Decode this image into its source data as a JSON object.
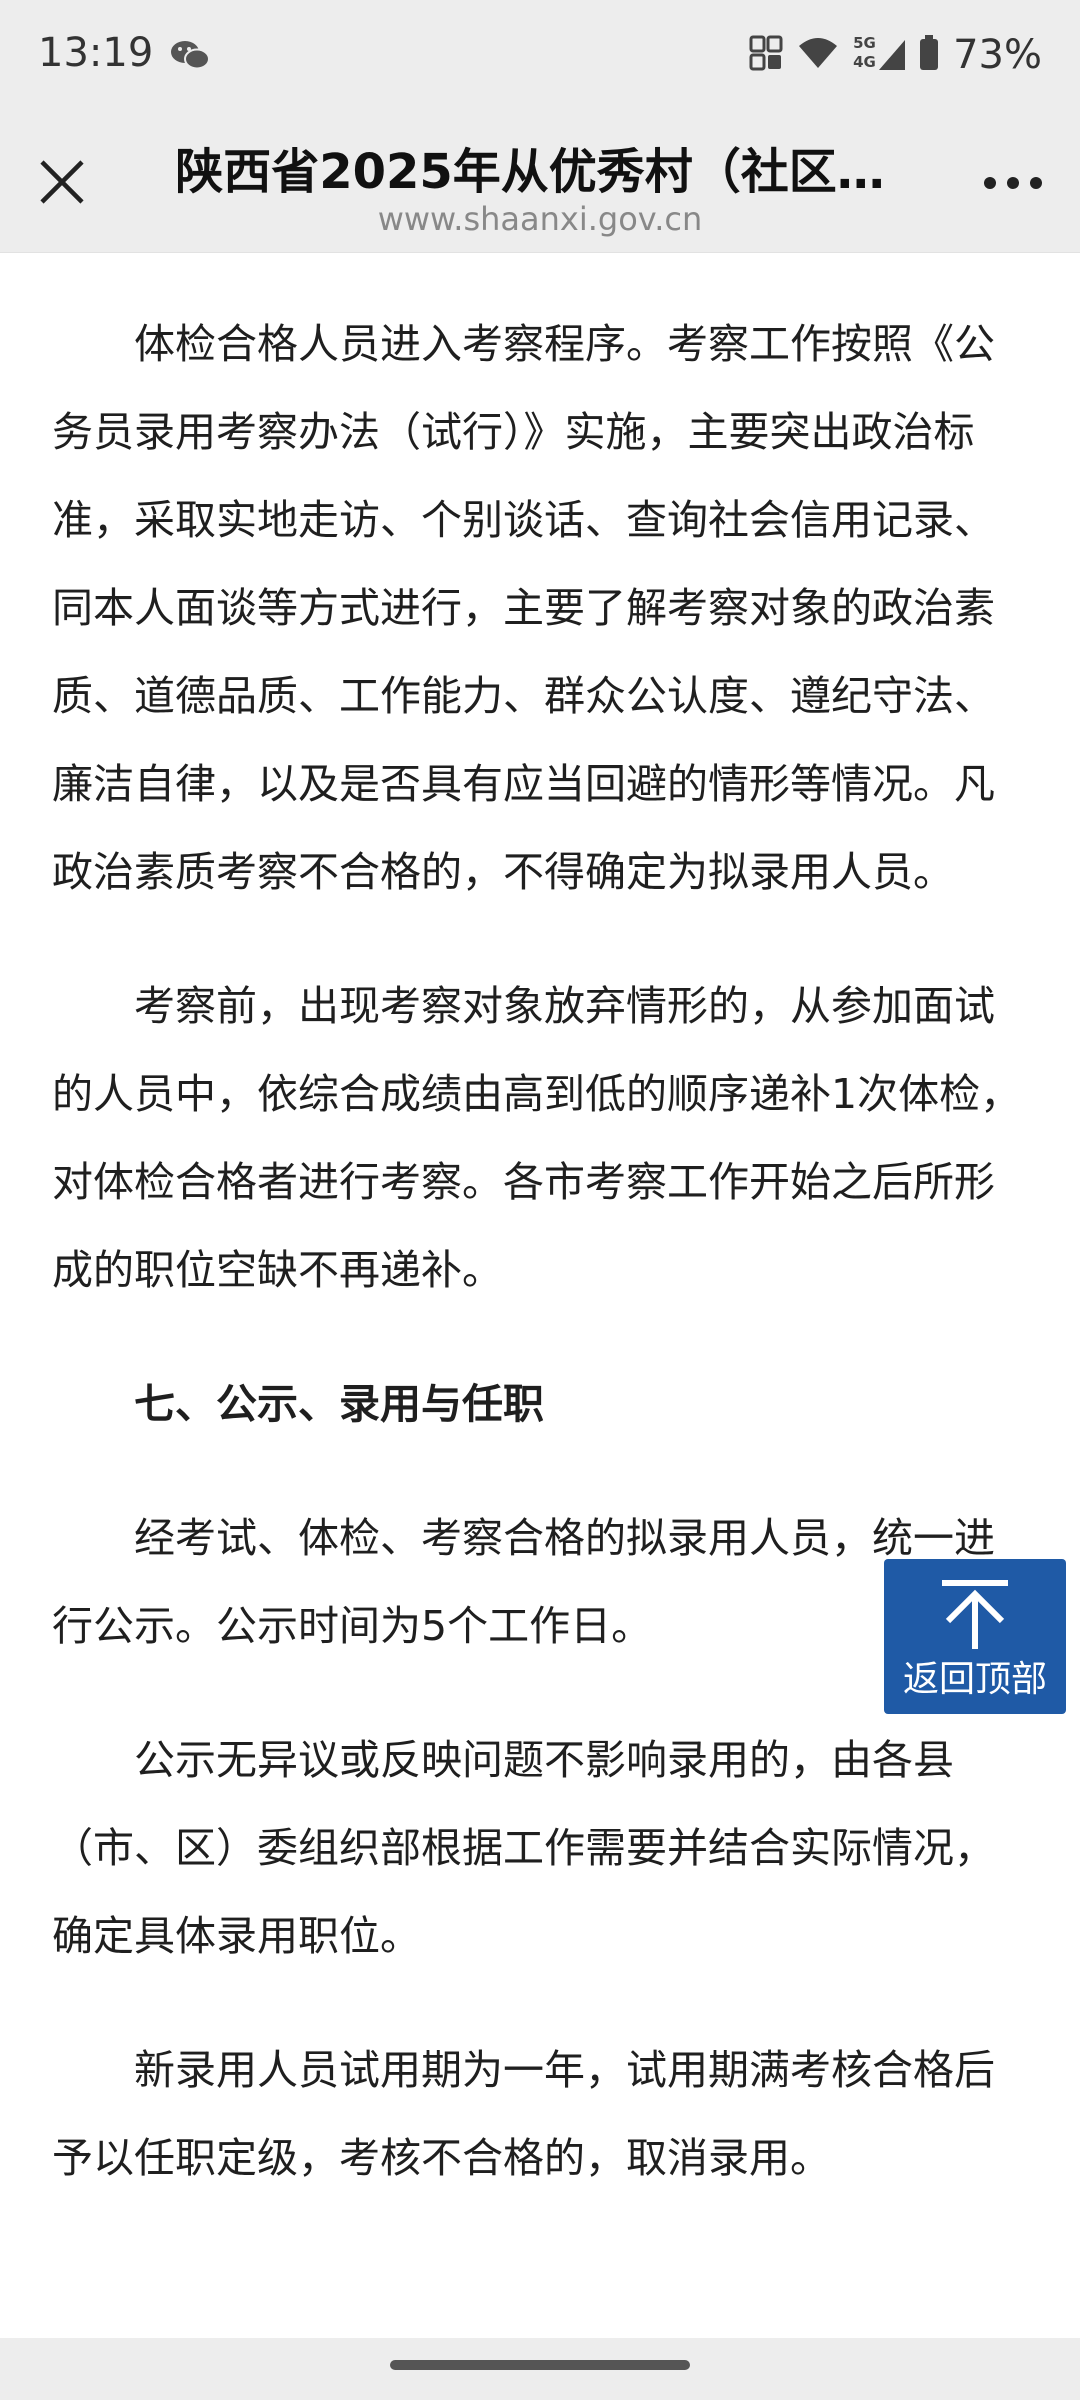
{
  "status_bar": {
    "time": "13:19",
    "battery": "73%",
    "network_5g": "5G",
    "network_4g": "4G",
    "icons": [
      "wechat-icon",
      "app-icon",
      "wifi-icon",
      "signal-icon",
      "battery-icon"
    ]
  },
  "title_bar": {
    "title": "陕西省2025年从优秀村（社区…",
    "domain": "www.shaanxi.gov.cn"
  },
  "article": {
    "paragraphs": [
      "体检合格人员进入考察程序。考察工作按照《公务员录用考察办法（试行）》实施，主要突出政治标准，采取实地走访、个别谈话、查询社会信用记录、同本人面谈等方式进行，主要了解考察对象的政治素质、道德品质、工作能力、群众公认度、遵纪守法、廉洁自律，以及是否具有应当回避的情形等情况。凡政治素质考察不合格的，不得确定为拟录用人员。",
      "考察前，出现考察对象放弃情形的，从参加面试的人员中，依综合成绩由高到低的顺序递补1次体检，对体检合格者进行考察。各市考察工作开始之后所形成的职位空缺不再递补。",
      "七、公示、录用与任职",
      "经考试、体检、考察合格的拟录用人员，统一进行公示。公示时间为5个工作日。",
      "公示无异议或反映问题不影响录用的，由各县（市、区）委组织部根据工作需要并结合实际情况，确定具体录用职位。",
      "新录用人员试用期为一年，试用期满考核合格后予以任职定级，考核不合格的，取消录用。"
    ]
  },
  "back_to_top": {
    "label": "返回顶部"
  }
}
